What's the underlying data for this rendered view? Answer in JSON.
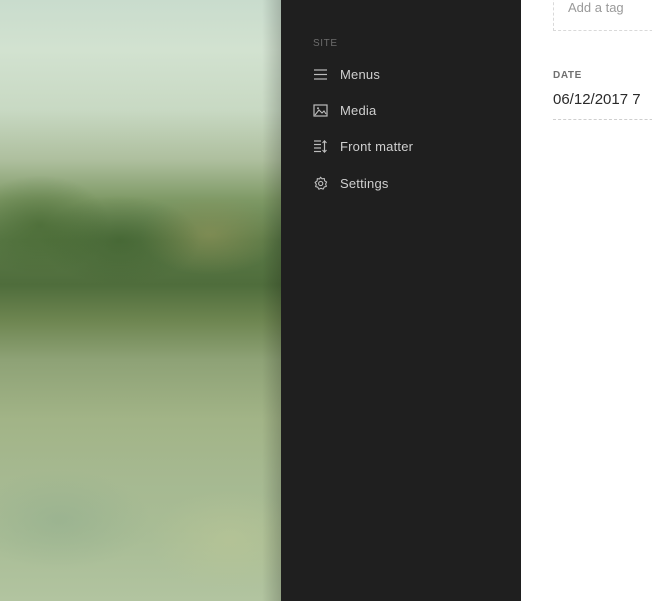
{
  "sidebar": {
    "section_label": "SITE",
    "items": [
      {
        "label": "Menus",
        "icon": "menu-lines-icon"
      },
      {
        "label": "Media",
        "icon": "image-icon"
      },
      {
        "label": "Front matter",
        "icon": "sort-list-icon"
      },
      {
        "label": "Settings",
        "icon": "gear-icon"
      }
    ]
  },
  "editor": {
    "tags_placeholder": "Add a tag",
    "date_label": "DATE",
    "date_value": "06/12/2017 7"
  },
  "colors": {
    "sidebar_bg": "#1f1f1f",
    "sidebar_text": "#cfcfcf",
    "section_label": "#6c6c6c"
  }
}
